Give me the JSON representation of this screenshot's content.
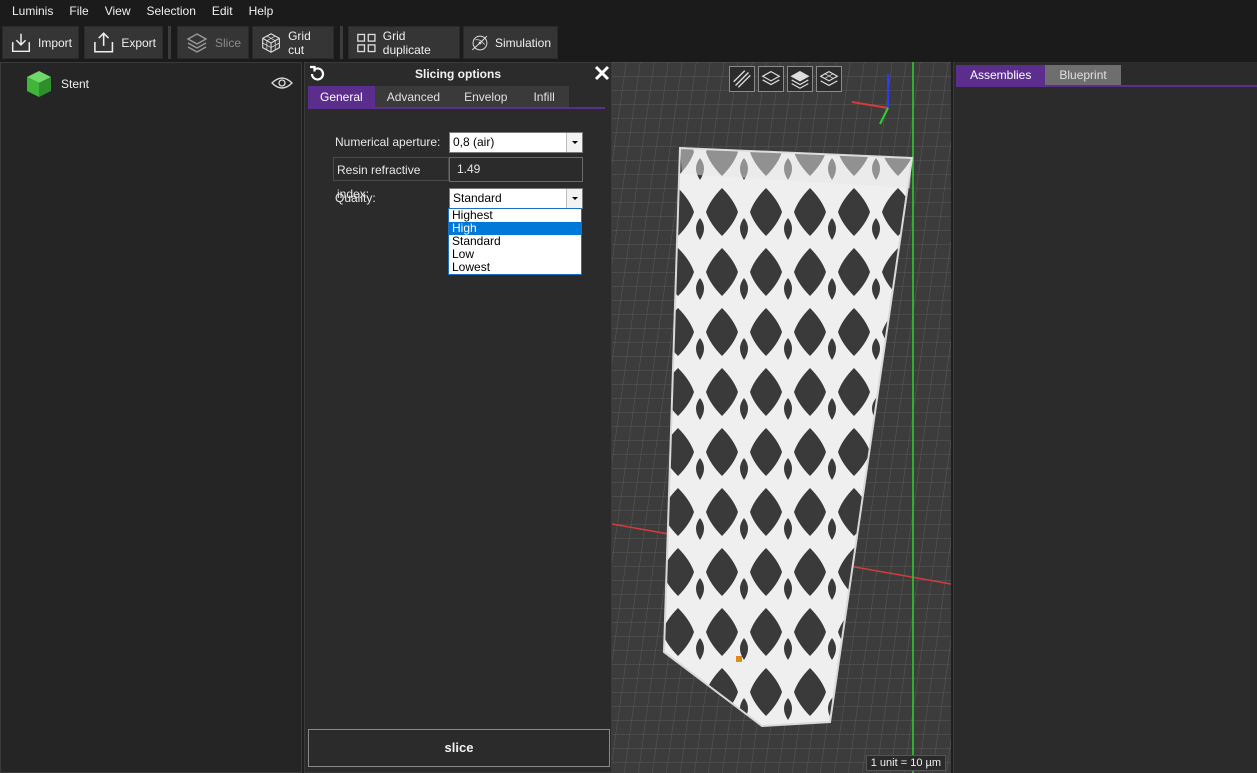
{
  "menu": [
    "Luminis",
    "File",
    "View",
    "Selection",
    "Edit",
    "Help"
  ],
  "toolbar": {
    "import": "Import",
    "export": "Export",
    "slice": "Slice",
    "grid_cut": "Grid cut",
    "grid_duplicate": "Grid duplicate",
    "simulation": "Simulation"
  },
  "tree": {
    "item_label": "Stent"
  },
  "slicing": {
    "title": "Slicing options",
    "tabs": [
      "General",
      "Advanced",
      "Envelop",
      "Infill"
    ],
    "active_tab": "General",
    "numerical_aperture_label": "Numerical aperture:",
    "numerical_aperture_value": "0,8 (air)",
    "resin_label": "Resin refractive index:",
    "resin_value": "1.49",
    "quality_label": "Quality:",
    "quality_value": "Standard",
    "quality_options": [
      "Highest",
      "High",
      "Standard",
      "Low",
      "Lowest"
    ],
    "quality_highlighted": "High",
    "slice_button": "slice"
  },
  "viewport": {
    "scale_label": "1 unit = 10 µm",
    "tools": [
      "slice-view-1-icon",
      "layers-icon",
      "layers-filled-icon",
      "layers-wire-icon"
    ]
  },
  "right_panel": {
    "tabs": [
      "Assemblies",
      "Blueprint"
    ],
    "active_tab": "Assemblies"
  },
  "colors": {
    "accent": "#5b2d8c",
    "selection": "#0078d7",
    "axis_x": "#d23c3c",
    "axis_y": "#2ed12e",
    "axis_z": "#2a3bff",
    "object_icon": "#3fb53a"
  }
}
